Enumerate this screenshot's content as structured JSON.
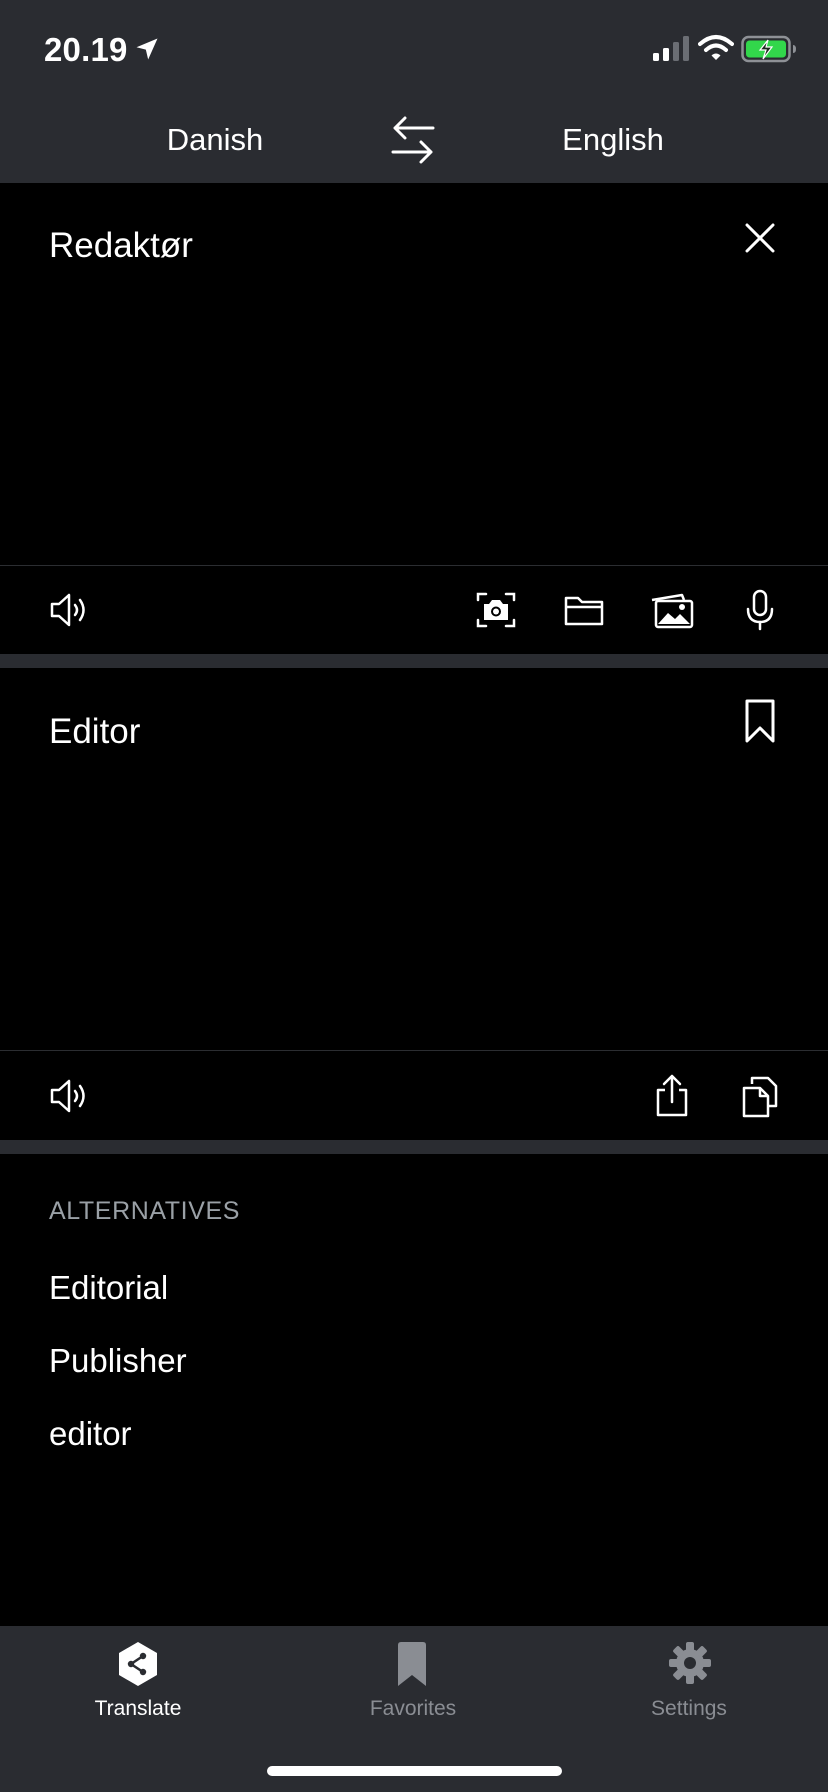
{
  "status_bar": {
    "time": "20.19"
  },
  "header": {
    "source_language": "Danish",
    "target_language": "English"
  },
  "source_panel": {
    "text": "Redaktør"
  },
  "target_panel": {
    "text": "Editor"
  },
  "alternatives": {
    "header": "ALTERNATIVES",
    "items": [
      "Editorial",
      "Publisher",
      "editor"
    ]
  },
  "tabbar": {
    "tabs": [
      {
        "label": "Translate",
        "icon": "translate-logo-icon",
        "active": true
      },
      {
        "label": "Favorites",
        "icon": "bookmark-icon",
        "active": false
      },
      {
        "label": "Settings",
        "icon": "gear-icon",
        "active": false
      }
    ]
  },
  "colors": {
    "background": "#000000",
    "header_bg": "#2a2c31",
    "battery_fill": "#32d74b",
    "inactive_tab": "#8a8d93"
  }
}
